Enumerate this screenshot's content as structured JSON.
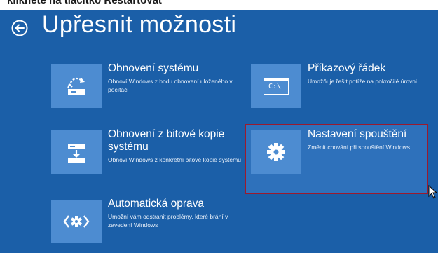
{
  "caption_strip": {
    "text": "kliknete na tlačítko Restartovat"
  },
  "header": {
    "title": "Upřesnit možnosti"
  },
  "options": [
    {
      "title": "Obnovení systému",
      "description": "Obnoví Windows z bodu obnovení uloženého v počítači",
      "icon": "system-restore-icon"
    },
    {
      "title": "Příkazový řádek",
      "description": "Umožňuje řešit potíže na pokročilé úrovni.",
      "icon": "command-prompt-icon",
      "icon_text": "C:\\"
    },
    {
      "title": "Obnovení z bitové kopie systému",
      "description": "Obnoví Windows z konkrétní bitové kopie systému",
      "icon": "system-image-icon"
    },
    {
      "title": "Nastavení spouštění",
      "description": "Změnit chování při spouštění Windows",
      "icon": "gear-icon",
      "selected": true
    },
    {
      "title": "Automatická oprava",
      "description": "Umožní vám odstranit problémy, které brání v zavedení Windows",
      "icon": "automatic-repair-icon"
    }
  ],
  "colors": {
    "background": "#1b5fa8",
    "tile": "#4d8cd1",
    "selection_border": "#9b1a2e"
  }
}
